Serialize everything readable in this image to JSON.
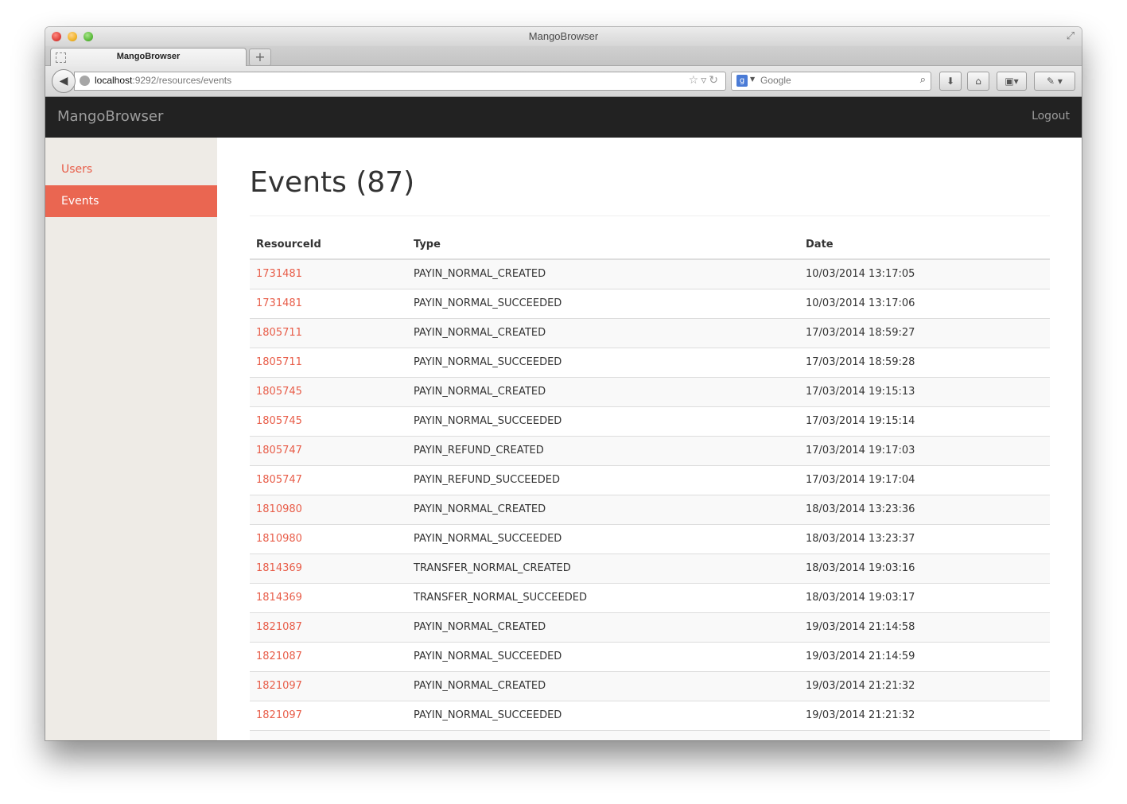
{
  "browser": {
    "window_title": "MangoBrowser",
    "tab_title": "MangoBrowser",
    "new_tab_label": "+",
    "url_host": "localhost",
    "url_rest": ":9292/resources/events",
    "search_placeholder": "Google"
  },
  "app": {
    "brand": "MangoBrowser",
    "logout_label": "Logout"
  },
  "sidebar": {
    "items": [
      {
        "label": "Users",
        "active": false
      },
      {
        "label": "Events",
        "active": true
      }
    ]
  },
  "main": {
    "title": "Events (87)",
    "columns": [
      "ResourceId",
      "Type",
      "Date"
    ],
    "rows": [
      {
        "id": "1731481",
        "type": "PAYIN_NORMAL_CREATED",
        "date": "10/03/2014 13:17:05"
      },
      {
        "id": "1731481",
        "type": "PAYIN_NORMAL_SUCCEEDED",
        "date": "10/03/2014 13:17:06"
      },
      {
        "id": "1805711",
        "type": "PAYIN_NORMAL_CREATED",
        "date": "17/03/2014 18:59:27"
      },
      {
        "id": "1805711",
        "type": "PAYIN_NORMAL_SUCCEEDED",
        "date": "17/03/2014 18:59:28"
      },
      {
        "id": "1805745",
        "type": "PAYIN_NORMAL_CREATED",
        "date": "17/03/2014 19:15:13"
      },
      {
        "id": "1805745",
        "type": "PAYIN_NORMAL_SUCCEEDED",
        "date": "17/03/2014 19:15:14"
      },
      {
        "id": "1805747",
        "type": "PAYIN_REFUND_CREATED",
        "date": "17/03/2014 19:17:03"
      },
      {
        "id": "1805747",
        "type": "PAYIN_REFUND_SUCCEEDED",
        "date": "17/03/2014 19:17:04"
      },
      {
        "id": "1810980",
        "type": "PAYIN_NORMAL_CREATED",
        "date": "18/03/2014 13:23:36"
      },
      {
        "id": "1810980",
        "type": "PAYIN_NORMAL_SUCCEEDED",
        "date": "18/03/2014 13:23:37"
      },
      {
        "id": "1814369",
        "type": "TRANSFER_NORMAL_CREATED",
        "date": "18/03/2014 19:03:16"
      },
      {
        "id": "1814369",
        "type": "TRANSFER_NORMAL_SUCCEEDED",
        "date": "18/03/2014 19:03:17"
      },
      {
        "id": "1821087",
        "type": "PAYIN_NORMAL_CREATED",
        "date": "19/03/2014 21:14:58"
      },
      {
        "id": "1821087",
        "type": "PAYIN_NORMAL_SUCCEEDED",
        "date": "19/03/2014 21:14:59"
      },
      {
        "id": "1821097",
        "type": "PAYIN_NORMAL_CREATED",
        "date": "19/03/2014 21:21:32"
      },
      {
        "id": "1821097",
        "type": "PAYIN_NORMAL_SUCCEEDED",
        "date": "19/03/2014 21:21:32"
      },
      {
        "id": "",
        "type": "",
        "date": ""
      }
    ]
  },
  "colors": {
    "accent": "#ea6651",
    "link": "#e85d49",
    "header_bg": "#222222",
    "sidebar_bg": "#eeebe6"
  },
  "icons": [
    "close-icon",
    "minimize-icon",
    "zoom-icon",
    "fullscreen-icon",
    "back-arrow-icon",
    "globe-icon",
    "bookmark-star-icon",
    "reload-icon",
    "search-engine-icon",
    "search-icon",
    "download-icon",
    "home-icon",
    "bookmarks-icon",
    "addons-icon"
  ]
}
